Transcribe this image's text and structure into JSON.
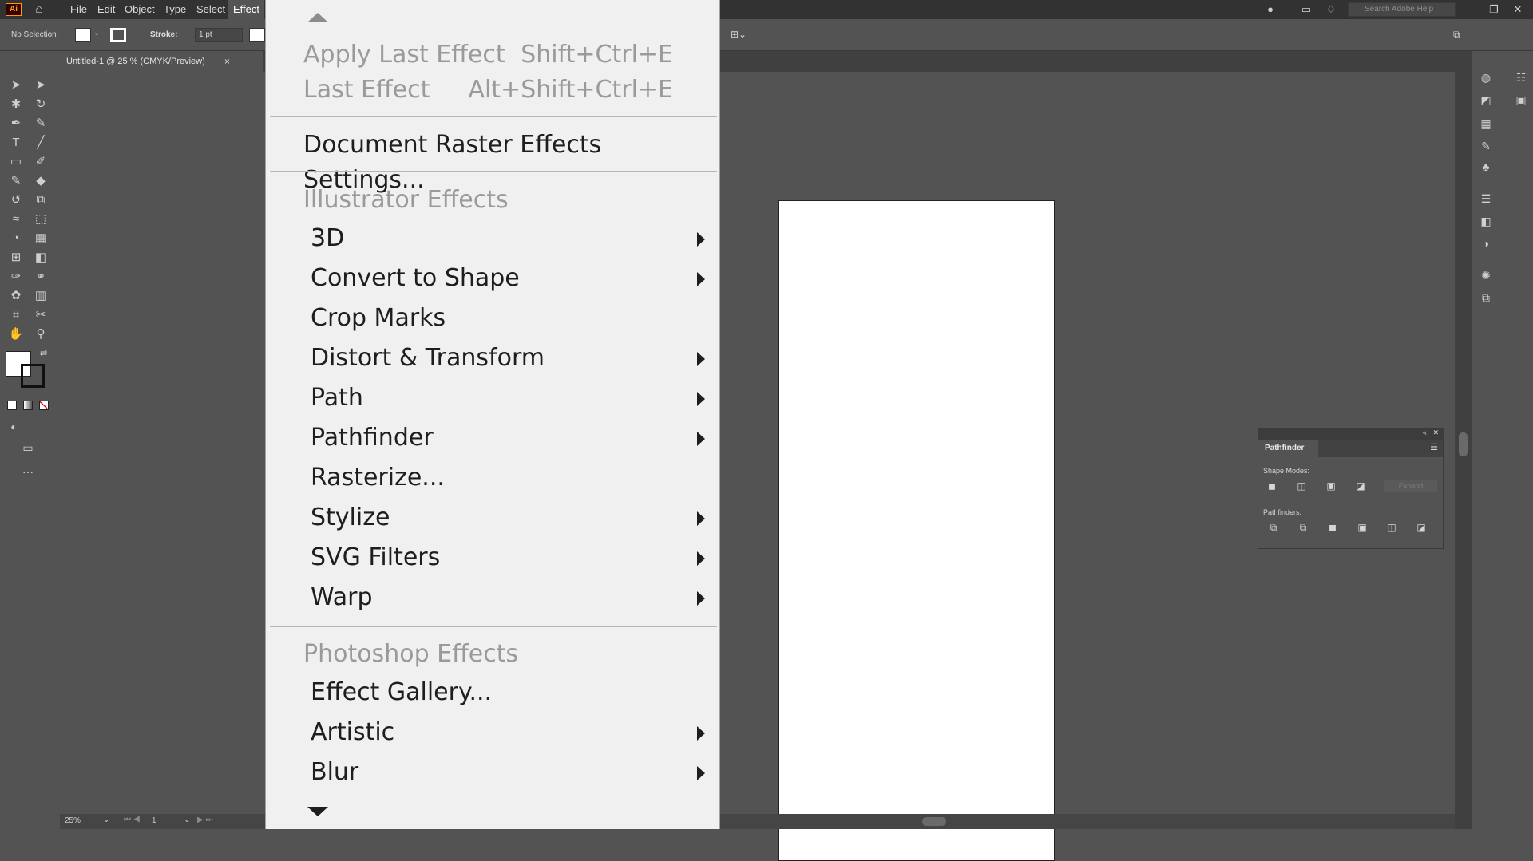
{
  "app": {
    "logo_text": "Ai",
    "menus": [
      "File",
      "Edit",
      "Object",
      "Type",
      "Select",
      "Effect"
    ]
  },
  "controlbar": {
    "selection_label": "No Selection",
    "stroke_label": "Stroke:",
    "stroke_value": "1 pt"
  },
  "document_tab": {
    "title": "Untitled-1 @ 25 % (CMYK/Preview)",
    "close": "×"
  },
  "search": {
    "placeholder": "Search Adobe Help"
  },
  "effect_menu": {
    "apply_last": {
      "label": "Apply Last Effect",
      "shortcut": "Shift+Ctrl+E"
    },
    "last": {
      "label": "Last Effect",
      "shortcut": "Alt+Shift+Ctrl+E"
    },
    "raster_settings": "Document Raster Effects Settings...",
    "illustrator_header": "Illustrator Effects",
    "illustrator_items": [
      {
        "label": "3D",
        "submenu": true
      },
      {
        "label": "Convert to Shape",
        "submenu": true
      },
      {
        "label": "Crop Marks",
        "submenu": false
      },
      {
        "label": "Distort & Transform",
        "submenu": true
      },
      {
        "label": "Path",
        "submenu": true
      },
      {
        "label": "Pathfinder",
        "submenu": true
      },
      {
        "label": "Rasterize...",
        "submenu": false
      },
      {
        "label": "Stylize",
        "submenu": true
      },
      {
        "label": "SVG Filters",
        "submenu": true
      },
      {
        "label": "Warp",
        "submenu": true
      }
    ],
    "photoshop_header": "Photoshop Effects",
    "photoshop_items": [
      {
        "label": "Effect Gallery...",
        "submenu": false
      },
      {
        "label": "Artistic",
        "submenu": true
      },
      {
        "label": "Blur",
        "submenu": true
      }
    ]
  },
  "pathfinder_panel": {
    "title": "Pathfinder",
    "shape_modes_label": "Shape Modes:",
    "pathfinders_label": "Pathfinders:",
    "expand_label": "Expand"
  },
  "statusbar": {
    "zoom": "25%",
    "artboard": "1"
  },
  "colors": {
    "menubar": "#323232",
    "workspace": "#535353",
    "menu_bg": "#f0f0f0",
    "accent_logo": "#ff9a00"
  }
}
